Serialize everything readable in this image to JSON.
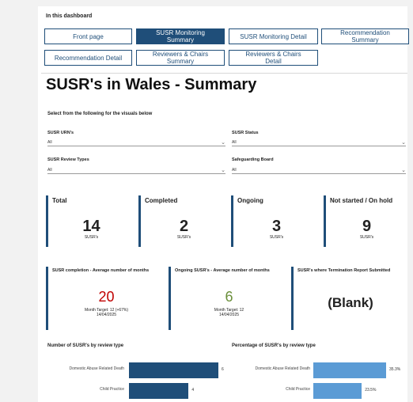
{
  "nav": {
    "title": "In this dashboard",
    "buttons": [
      {
        "label": "Front page"
      },
      {
        "label": "SUSR Monitoring\nSummary"
      },
      {
        "label": "SUSR Monitoring Detail"
      },
      {
        "label": "Recommendation\nSummary"
      },
      {
        "label": "Recommendation Detail"
      },
      {
        "label": "Reviewers & Chairs\nSummary"
      },
      {
        "label": "Reviewers & Chairs\nDetail"
      }
    ],
    "active": "SUSR Monitoring Summary"
  },
  "page": {
    "title": "SUSR's in Wales - Summary",
    "subtitle": "Select from the following for the visuals below"
  },
  "filters": [
    {
      "label": "SUSR URN's",
      "value": "All"
    },
    {
      "label": "SUSR Status",
      "value": "All"
    },
    {
      "label": "SUSR Review Types",
      "value": "All"
    },
    {
      "label": "Safeguarding Board",
      "value": "All"
    }
  ],
  "kpis": [
    {
      "label": "Total",
      "value": "14",
      "unit": "SUSR's"
    },
    {
      "label": "Completed",
      "value": "2",
      "unit": "SUSR's"
    },
    {
      "label": "Ongoing",
      "value": "3",
      "unit": "SUSR's"
    },
    {
      "label": "Not started / On hold",
      "value": "9",
      "unit": "SUSR's"
    }
  ],
  "metrics": [
    {
      "label": "SUSR completion - Average number of months",
      "value": "20",
      "target": "Month Target: 12 (+67%)",
      "date": "14/04/2025",
      "color": "#c00000"
    },
    {
      "label": "Ongoing SUSR's - Average number of months",
      "value": "6",
      "target": "Month Target: 12",
      "date": "14/04/2025",
      "color": "#6a8f3a"
    },
    {
      "label": "SUSR's where Termination Report Submitted",
      "value": "(Blank)"
    }
  ],
  "charts": {
    "count": {
      "title": "Number of SUSR's by review type",
      "color": "#1f4e79",
      "rows": [
        {
          "label": "Domestic Abuse Related Death",
          "value": 6
        },
        {
          "label": "Child Practice",
          "value": 4
        }
      ]
    },
    "percent": {
      "title": "Percentage of SUSR's by review type",
      "color": "#5b9bd5",
      "rows": [
        {
          "label": "Domestic Abuse Related Death",
          "value": 35.3,
          "display": "35.3%"
        },
        {
          "label": "Child Practice",
          "value": 23.5,
          "display": "23.5%"
        }
      ]
    }
  },
  "colors": {
    "accent": "#1f4e79",
    "light_accent": "#5b9bd5"
  }
}
